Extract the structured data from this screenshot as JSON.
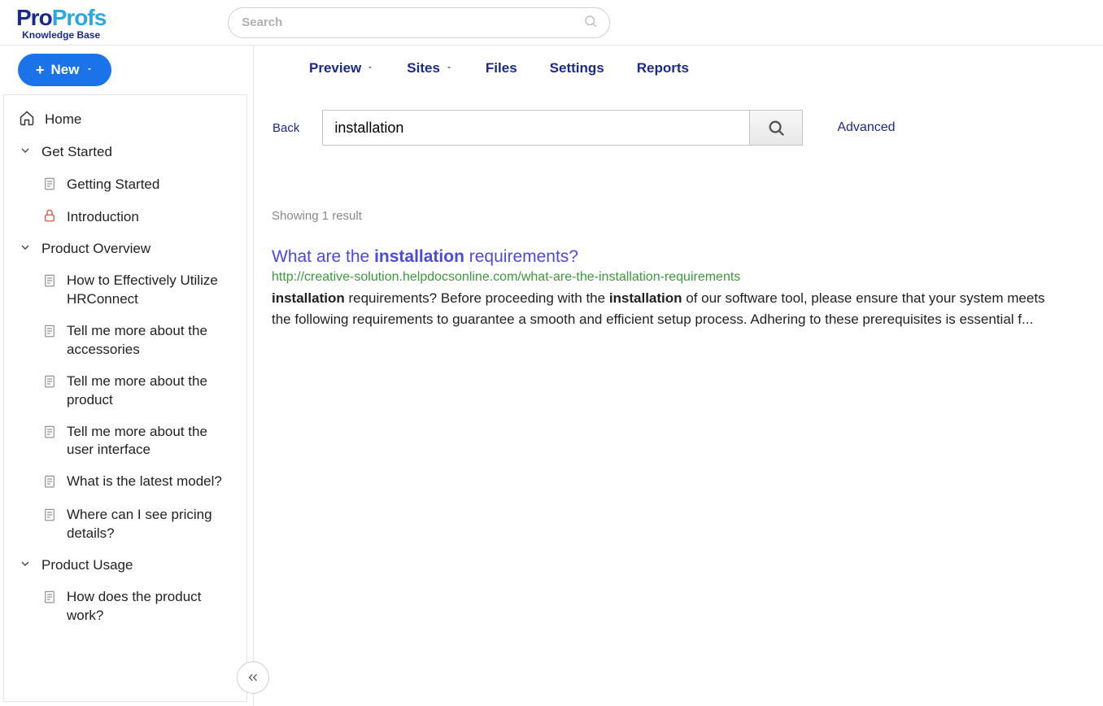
{
  "brand": {
    "part1": "Pro",
    "part2": "Profs",
    "sub": "Knowledge Base"
  },
  "top_search": {
    "placeholder": "Search"
  },
  "new_button": {
    "label": "New"
  },
  "sidebar": [
    {
      "type": "home",
      "label": "Home"
    },
    {
      "type": "section",
      "label": "Get Started"
    },
    {
      "type": "doc",
      "level": 1,
      "label": "Getting Started"
    },
    {
      "type": "lock",
      "level": 1,
      "label": "Introduction"
    },
    {
      "type": "section",
      "label": "Product Overview"
    },
    {
      "type": "doc",
      "level": 2,
      "label": "How to Effectively Utilize HRConnect"
    },
    {
      "type": "doc",
      "level": 2,
      "label": "Tell me more about the accessories"
    },
    {
      "type": "doc",
      "level": 2,
      "label": "Tell me more about the product"
    },
    {
      "type": "doc",
      "level": 2,
      "label": "Tell me more about the user interface"
    },
    {
      "type": "doc",
      "level": 2,
      "label": "What is the latest model?"
    },
    {
      "type": "doc",
      "level": 2,
      "label": "Where can I see pricing details?"
    },
    {
      "type": "section",
      "label": "Product Usage"
    },
    {
      "type": "doc",
      "level": 2,
      "label": "How does the product work?"
    }
  ],
  "tabs": [
    {
      "label": "Preview",
      "dropdown": true
    },
    {
      "label": "Sites",
      "dropdown": true
    },
    {
      "label": "Files",
      "dropdown": false
    },
    {
      "label": "Settings",
      "dropdown": false
    },
    {
      "label": "Reports",
      "dropdown": false
    }
  ],
  "search": {
    "back": "Back",
    "query": "installation",
    "advanced": "Advanced"
  },
  "results": {
    "count_text": "Showing 1 result",
    "item": {
      "title_pre": "What are the ",
      "title_hl": "installation",
      "title_post": " requirements?",
      "url": "http://creative-solution.helpdocsonline.com/what-are-the-installation-requirements",
      "snip_hl1": "installation",
      "snip_1": " requirements? Before proceeding with the ",
      "snip_hl2": "installation",
      "snip_2": " of our software tool, please ensure that your system meets the following requirements to guarantee a smooth and efficient setup process. Adhering to these prerequisites is essential f..."
    }
  }
}
